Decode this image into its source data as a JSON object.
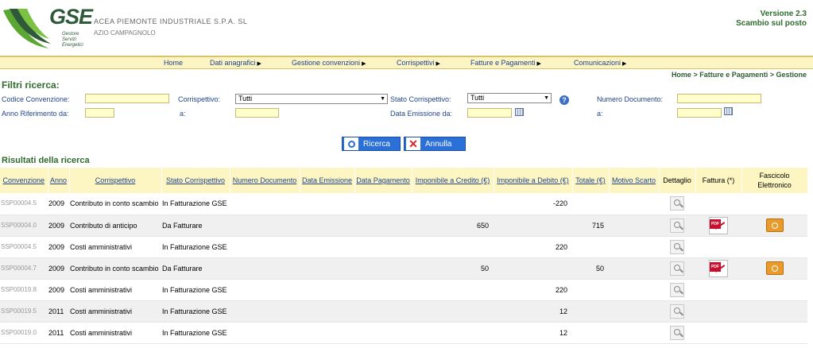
{
  "header": {
    "logo_text": "GSE",
    "logo_sub": [
      "Gestore",
      "Servizi",
      "Energetici"
    ],
    "company_name": "ACEA PIEMONTE INDUSTRIALE S.P.A. SL",
    "company_sub": "AZIO CAMPAGNOLO",
    "version": "Versione 2.3",
    "module": "Scambio sul posto"
  },
  "nav": {
    "items": [
      {
        "label": "Home",
        "has_arrow": false
      },
      {
        "label": "Dati anagrafici",
        "has_arrow": true
      },
      {
        "label": "Gestione convenzioni",
        "has_arrow": true
      },
      {
        "label": "Corrispettivi",
        "has_arrow": true
      },
      {
        "label": "Fatture e Pagamenti",
        "has_arrow": true
      },
      {
        "label": "Comunicazioni",
        "has_arrow": true
      }
    ],
    "arrow_glyph": "▶"
  },
  "breadcrumb": "Home > Fatture e Pagamenti > Gestione",
  "filters": {
    "title": "Filtri ricerca:",
    "codice_convenzione_label": "Codice Convenzione:",
    "corrispettivo_label": "Corrispettivo:",
    "corrispettivo_value": "Tutti",
    "stato_label": "Stato Corrispettivo:",
    "stato_value": "Tutti",
    "numero_documento_label": "Numero Documento:",
    "anno_da_label": "Anno Riferimento da:",
    "a_label": "a:",
    "data_emissione_label": "Data Emissione da:",
    "a2_label": "a:",
    "help_glyph": "?"
  },
  "buttons": {
    "ricerca": "Ricerca",
    "annulla": "Annulla"
  },
  "results": {
    "title": "Risultati della ricerca",
    "columns": [
      "Convenzione",
      "Anno",
      "Corrispettivo",
      "Stato Corrispettivo",
      "Numero Documento",
      "Data Emissione",
      "Data Pagamento",
      "Imponibile a Credito (€)",
      "Imponibile a Debito (€)",
      "Totale (€)",
      "Motivo Scarto",
      "Dettaglio",
      "Fattura (*)",
      "Fascicolo Elettronico"
    ],
    "rows": [
      {
        "convenzione": "SSP00004.5",
        "anno": "2009",
        "corrispettivo": "Contributo in conto scambio",
        "stato": "In Fatturazione GSE",
        "credito": "",
        "debito": "-220",
        "totale": "",
        "fattura": false,
        "fascicolo": false
      },
      {
        "convenzione": "SSP00004.0",
        "anno": "2009",
        "corrispettivo": "Contributo di anticipo",
        "stato": "Da Fatturare",
        "credito": "650",
        "debito": "",
        "totale": "715",
        "fattura": true,
        "fascicolo": true
      },
      {
        "convenzione": "SSP00004.5",
        "anno": "2009",
        "corrispettivo": "Costi amministrativi",
        "stato": "In Fatturazione GSE",
        "credito": "",
        "debito": "220",
        "totale": "",
        "fattura": false,
        "fascicolo": false
      },
      {
        "convenzione": "SSP00004.7",
        "anno": "2009",
        "corrispettivo": "Contributo in conto scambio",
        "stato": "Da Fatturare",
        "credito": "50",
        "debito": "",
        "totale": "50",
        "fattura": true,
        "fascicolo": true
      },
      {
        "convenzione": "SSP00019.8",
        "anno": "2009",
        "corrispettivo": "Costi amministrativi",
        "stato": "In Fatturazione GSE",
        "credito": "",
        "debito": "220",
        "totale": "",
        "fattura": false,
        "fascicolo": false
      },
      {
        "convenzione": "SSP00019.5",
        "anno": "2011",
        "corrispettivo": "Costi amministrativi",
        "stato": "In Fatturazione GSE",
        "credito": "",
        "debito": "12",
        "totale": "",
        "fattura": false,
        "fascicolo": false
      },
      {
        "convenzione": "SSP00019.0",
        "anno": "2011",
        "corrispettivo": "Costi amministrativi",
        "stato": "In Fatturazione GSE",
        "credito": "",
        "debito": "12",
        "totale": "",
        "fattura": false,
        "fascicolo": false
      }
    ]
  }
}
